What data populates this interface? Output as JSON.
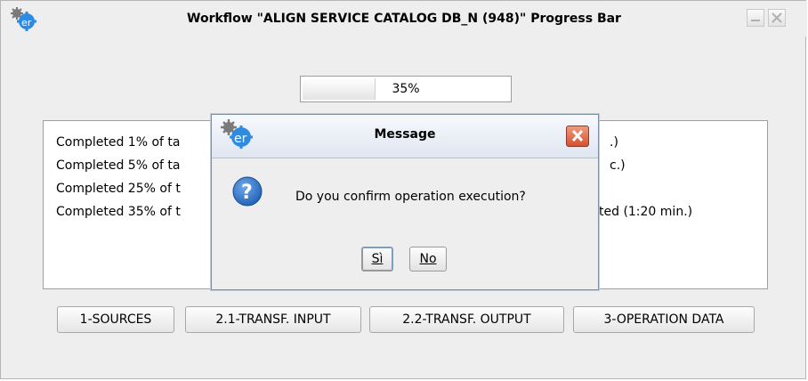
{
  "window": {
    "title": "Workflow \"ALIGN SERVICE CATALOG DB_N (948)\" Progress Bar",
    "app_icon": "er-gear-icon"
  },
  "progress": {
    "value": 0.35,
    "label": "35%"
  },
  "log": {
    "lines": [
      "Completed 1% of ta",
      "Completed 5% of ta",
      "Completed 25% of t",
      "Completed 35% of t"
    ],
    "right_fragments": [
      ".)",
      "c.)",
      "",
      "ted  (1:20 min.)"
    ]
  },
  "buttons": {
    "sources": "1-SOURCES",
    "transf_input": "2.1-TRANSF. INPUT",
    "transf_output": "2.2-TRANSF. OUTPUT",
    "operation_data": "3-OPERATION DATA"
  },
  "dialog": {
    "title": "Message",
    "message": "Do you confirm operation execution?",
    "yes_label": "Sì",
    "no_label": "No",
    "icon": "question-icon"
  },
  "colors": {
    "dialog_close": "#d5512f",
    "question_icon": "#1f5fb4"
  }
}
